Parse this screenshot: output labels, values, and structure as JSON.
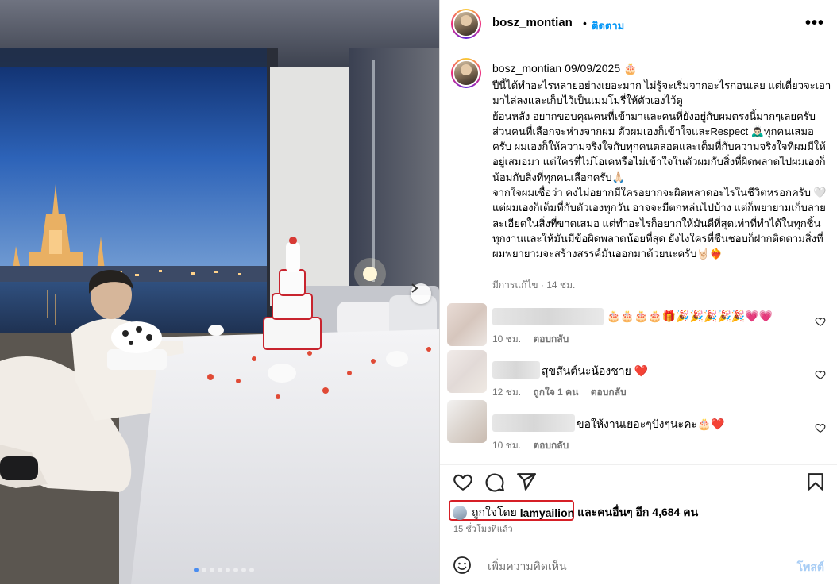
{
  "post": {
    "username": "bosz_montian",
    "follow_label": "ติดตาม",
    "separator": "•",
    "more_icon": "more-horizontal-icon",
    "image": {
      "description_icon": "photo",
      "carousel_total": 8,
      "carousel_active": 1
    }
  },
  "caption": {
    "username": "bosz_montian",
    "date_text": "09/09/2025 🎂",
    "body": "ปีนี้ได้ทำอะไรหลายอย่างเยอะมาก ไม่รู้จะเริ่มจากอะไรก่อนเลย แต่เดี๋ยวจะเอามาไล่ลงและเก็บไว้เป็นเมมโมรี่ให้ตัวเองไว้ดู\nย้อนหลัง อยากขอบคุณคนที่เข้ามาและคนที่ยังอยู่กับผมตรงนี้มากๆเลยครับ ส่วนคนที่เลือกจะห่างจากผม ตัวผมเองก็เข้าใจและRespect 🙇🏻‍♂️ทุกคนเสมอครับ ผมเองก็ให้ความจริงใจกับทุกคนตลอดและเต็มที่กับความจริงใจที่ผมมีให้อยู่เสมอมา แต่ใครที่ไม่โอเคหรือไม่เข้าใจในตัวผมกับสิ่งที่ผิดพลาดไปผมเองก็น้อมกับสิ่งที่ทุกคนเลือกครับ🙏🏻\nจากใจผมเชื่อว่า คงไม่อยากมีใครอยากจะผิดพลาดอะไรในชีวิตหรอกครับ 🤍แต่ผมเองก็เต็มที่กับตัวเองทุกวัน อาจจะมีตกหล่นไปบ้าง แต่ก็พยายามเก็บลายละเอียดในสิ่งที่ขาดเสมอ แต่ทำอะไรก็อยากให้มันดีที่สุดเท่าที่ทำได้ในทุกชิ้นทุกงานและให้มันมีข้อผิดพลาดน้อยที่สุด ยังไงใครที่ชื่นชอบก็ฝากติดตามสิ่งที่ผมพยายามจะสร้างสรรค์มันออกมาด้วยนะครับ🤘🏻❤️‍🔥",
    "meta": "มีการแก้ไข · 14 ชม."
  },
  "comments": [
    {
      "text": "🎂🎂🎂🎂🎁🎉🎉🎉🎉🎉💗💗",
      "time": "10 ชม.",
      "likes": "",
      "reply": "ตอบกลับ"
    },
    {
      "text": "สุขสันต์นะน้องชาย ❤️",
      "time": "12 ชม.",
      "likes": "ถูกใจ 1 คน",
      "reply": "ตอบกลับ"
    },
    {
      "text": "ขอให้งานเยอะๆปังๆนะคะ🎂❤️",
      "time": "10 ชม.",
      "likes": "",
      "reply": "ตอบกลับ"
    }
  ],
  "actions": {
    "like_icon": "heart-icon",
    "comment_icon": "comment-icon",
    "share_icon": "share-icon",
    "save_icon": "bookmark-icon"
  },
  "likes": {
    "prefix": "ถูกใจโดย",
    "liker": "lamyailion",
    "suffix": "และคนอื่นๆ อีก 4,684 คน",
    "time_ago": "15 ชั่วโมงที่แล้ว",
    "highlight_color": "#d61f26"
  },
  "add_comment": {
    "placeholder": "เพิ่มความคิดเห็น",
    "post_label": "โพสต์"
  }
}
